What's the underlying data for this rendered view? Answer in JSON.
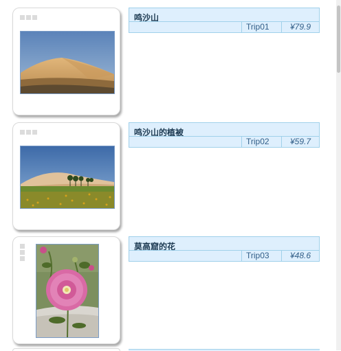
{
  "items": [
    {
      "title": "鸣沙山",
      "code": "Trip01",
      "price": "¥79.9",
      "image": "desert-dunes-photo"
    },
    {
      "title": "鸣沙山的植被",
      "code": "Trip02",
      "price": "¥59.7",
      "image": "desert-vegetation-photo"
    },
    {
      "title": "莫高窟的花",
      "code": "Trip03",
      "price": "¥48.6",
      "image": "hollyhock-flower-photo"
    }
  ],
  "colors": {
    "info_bg": "#deeffd",
    "info_border": "#9fd0ea",
    "title": "#1d3a52",
    "detail_text": "#305d87"
  }
}
